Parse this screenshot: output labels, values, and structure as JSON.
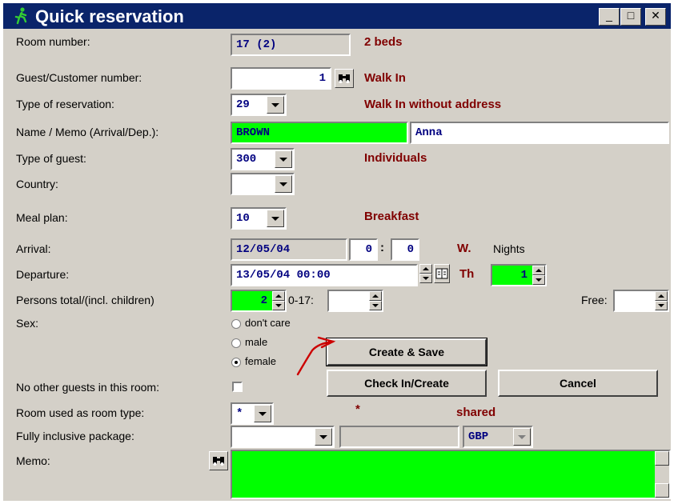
{
  "window": {
    "title": "Quick reservation",
    "minimize": "_",
    "maximize": "□",
    "close": "✕"
  },
  "labels": {
    "room_number": "Room number:",
    "guest_number": "Guest/Customer number:",
    "reservation_type": "Type of reservation:",
    "name_memo": "Name / Memo (Arrival/Dep.):",
    "guest_type": "Type of guest:",
    "country": "Country:",
    "meal_plan": "Meal plan:",
    "arrival": "Arrival:",
    "departure": "Departure:",
    "persons": "Persons total/(incl. children)",
    "sex": "Sex:",
    "no_other_guests": "No other guests in this room:",
    "room_type": "Room used as room type:",
    "package": "Fully inclusive package:",
    "memo": "Memo:",
    "nights": "Nights",
    "children_range": "0-17:",
    "free": "Free:"
  },
  "fields": {
    "room_number": "17 (2)",
    "guest_number": "1",
    "reservation_type": "29",
    "last_name": "BROWN",
    "first_name": "Anna",
    "guest_type": "300",
    "country": "",
    "meal_plan": "10",
    "arrival_date": "12/05/04",
    "arrival_hour": "0",
    "arrival_minute": "0",
    "departure": "13/05/04 00:00",
    "nights": "1",
    "persons": "2",
    "children": "",
    "free": "",
    "room_type": "*",
    "package": "",
    "package_price": "",
    "currency": "GBP",
    "memo": ""
  },
  "info": {
    "room_beds": "2 beds",
    "guest_name": "Walk In",
    "reservation_type_desc": "Walk In without address",
    "guest_type_desc": "Individuals",
    "meal_plan_desc": "Breakfast",
    "arrival_weekday": "W.",
    "departure_weekday": "Th",
    "room_type_mark": "*",
    "room_type_desc": "shared"
  },
  "sex_options": [
    "don't care",
    "male",
    "female"
  ],
  "sex_selected": "female",
  "no_other_guests_checked": false,
  "buttons": {
    "create_save": "Create & Save",
    "check_in": "Check In/Create",
    "cancel": "Cancel"
  },
  "colors": {
    "title_bar": "#0a246a",
    "face": "#d4d0c8",
    "highlight": "#00ff00",
    "info_text": "#800000",
    "field_text": "#000080",
    "annotation": "#cc0000"
  },
  "icons": [
    "walking-person-icon",
    "binoculars-icon",
    "calendar-icon",
    "annotation-arrow"
  ]
}
